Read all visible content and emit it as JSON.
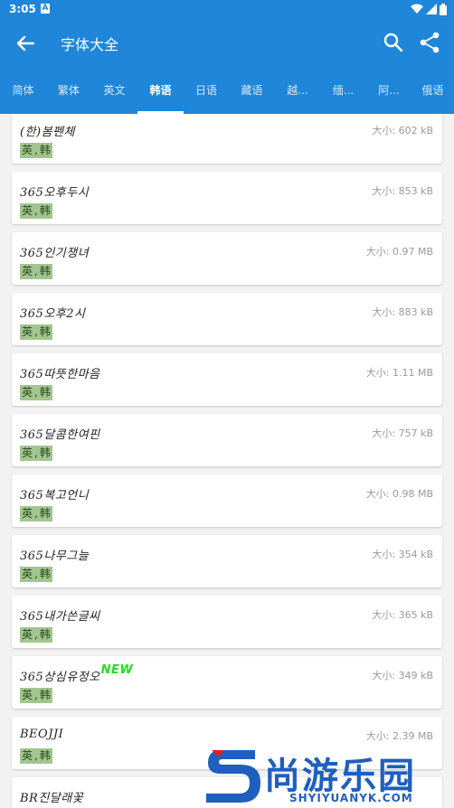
{
  "status_bar": {
    "time": "3:05",
    "notification_icon": "A"
  },
  "app_bar": {
    "title": "字体大全",
    "back_icon": "arrow-left-icon",
    "search_icon": "search-icon",
    "share_icon": "share-icon"
  },
  "tabs": [
    {
      "label": "简体"
    },
    {
      "label": "繁体"
    },
    {
      "label": "英文"
    },
    {
      "label": "韩语"
    },
    {
      "label": "日语"
    },
    {
      "label": "藏语"
    },
    {
      "label": "越..."
    },
    {
      "label": "缅..."
    },
    {
      "label": "阿..."
    },
    {
      "label": "俄语"
    }
  ],
  "active_tab": "韩语",
  "fonts": [
    {
      "name": "(한)봄펜체",
      "size": "大小: 602 kB",
      "tags": [
        "英",
        "韩"
      ]
    },
    {
      "name": "365오후두시",
      "size": "大小: 853 kB",
      "tags": [
        "英",
        "韩"
      ]
    },
    {
      "name": "365인기쟁녀",
      "size": "大小: 0.97 MB",
      "tags": [
        "英",
        "韩"
      ]
    },
    {
      "name": "365오후2시",
      "size": "大小: 883 kB",
      "tags": [
        "英",
        "韩"
      ]
    },
    {
      "name": "365따뜻한마음",
      "size": "大小: 1.11 MB",
      "tags": [
        "英",
        "韩"
      ]
    },
    {
      "name": "365달콤한여핀",
      "size": "大小: 757 kB",
      "tags": [
        "英",
        "韩"
      ]
    },
    {
      "name": "365복고언니",
      "size": "大小: 0.98 MB",
      "tags": [
        "英",
        "韩"
      ]
    },
    {
      "name": "365나무그늘",
      "size": "大小: 354 kB",
      "tags": [
        "英",
        "韩"
      ]
    },
    {
      "name": "365내가쓴글씨",
      "size": "大小: 365 kB",
      "tags": [
        "英",
        "韩"
      ]
    },
    {
      "name": "365상심유정오",
      "size": "大小: 349 kB",
      "tags": [
        "英",
        "韩"
      ],
      "badge": "NEW"
    },
    {
      "name": "BEOJJI",
      "size": "大小: 2.39 MB",
      "tags": [
        "英",
        "韩"
      ]
    },
    {
      "name": "BR진달래꽃",
      "size": "",
      "tags": []
    }
  ],
  "watermark": {
    "text": "尚游乐园",
    "url": "SHYIYUANYK.COM"
  },
  "colors": {
    "primary": "#1f86d9",
    "tag_bg": "#a3c58f",
    "new_badge": "#22dd22",
    "watermark": "#1f5fbf"
  }
}
